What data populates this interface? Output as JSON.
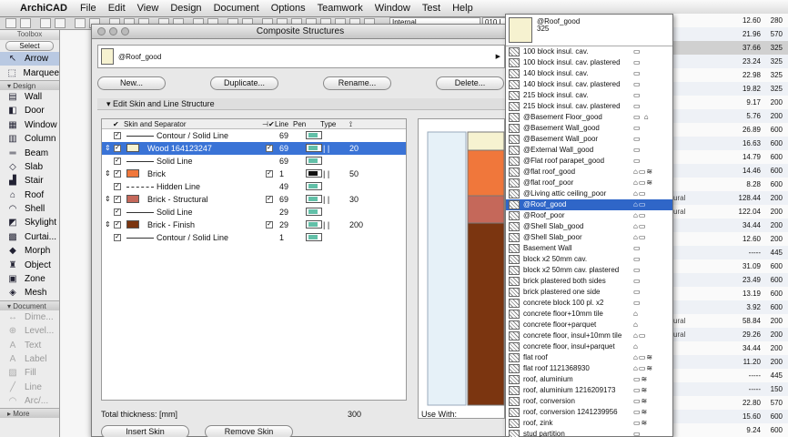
{
  "menubar": {
    "app": "ArchiCAD",
    "items": [
      "File",
      "Edit",
      "View",
      "Design",
      "Document",
      "Options",
      "Teamwork",
      "Window",
      "Test",
      "Help"
    ]
  },
  "topbar": {
    "layer": "Internal",
    "layer2": "010 L"
  },
  "toolbox": {
    "title": "Toolbox",
    "select": "Select",
    "tools_a": [
      {
        "label": "Arrow",
        "icon": "arrow-icon",
        "active": true
      },
      {
        "label": "Marquee",
        "icon": "marquee-icon"
      }
    ],
    "design_header": "Design",
    "tools_b": [
      {
        "label": "Wall",
        "icon": "wall-icon"
      },
      {
        "label": "Door",
        "icon": "door-icon"
      },
      {
        "label": "Window",
        "icon": "window-icon"
      },
      {
        "label": "Column",
        "icon": "column-icon"
      },
      {
        "label": "Beam",
        "icon": "beam-icon"
      },
      {
        "label": "Slab",
        "icon": "slab-icon"
      },
      {
        "label": "Stair",
        "icon": "stair-icon"
      },
      {
        "label": "Roof",
        "icon": "roof-icon"
      },
      {
        "label": "Shell",
        "icon": "shell-icon"
      },
      {
        "label": "Skylight",
        "icon": "skylight-icon"
      },
      {
        "label": "Curtai...",
        "icon": "curtain-wall-icon"
      },
      {
        "label": "Morph",
        "icon": "morph-icon"
      },
      {
        "label": "Object",
        "icon": "object-icon"
      },
      {
        "label": "Zone",
        "icon": "zone-icon"
      },
      {
        "label": "Mesh",
        "icon": "mesh-icon"
      }
    ],
    "document_header": "Document",
    "tools_c": [
      {
        "label": "Dime...",
        "icon": "dimension-icon"
      },
      {
        "label": "Level...",
        "icon": "level-icon"
      },
      {
        "label": "Text",
        "icon": "text-icon"
      },
      {
        "label": "Label",
        "icon": "label-icon"
      },
      {
        "label": "Fill",
        "icon": "fill-icon"
      },
      {
        "label": "Line",
        "icon": "line-icon"
      },
      {
        "label": "Arc/...",
        "icon": "arc-icon"
      }
    ],
    "more": "More"
  },
  "dialog": {
    "title": "Composite Structures",
    "name": "@Roof_good",
    "buttons": {
      "new": "New...",
      "duplicate": "Duplicate...",
      "rename": "Rename...",
      "delete": "Delete..."
    },
    "section": "Edit Skin and Line Structure",
    "headers": {
      "skin": "Skin and Separator",
      "line": "Line",
      "pen": "Pen",
      "type": "Type"
    },
    "rows": [
      {
        "kind": "line",
        "label": "Contour / Solid Line",
        "pen": "69",
        "thick": ""
      },
      {
        "kind": "skin",
        "label": "Wood 164123247",
        "pen": "69",
        "thick": "20",
        "color": "#f6f2d0",
        "selected": true
      },
      {
        "kind": "line",
        "label": "Solid Line",
        "pen": "69",
        "thick": ""
      },
      {
        "kind": "skin",
        "label": "Brick",
        "pen": "1",
        "thick": "50",
        "color": "#f0773b"
      },
      {
        "kind": "dash",
        "label": "Hidden Line",
        "pen": "49",
        "thick": ""
      },
      {
        "kind": "skin",
        "label": "Brick - Structural",
        "pen": "69",
        "thick": "30",
        "color": "#c5685a"
      },
      {
        "kind": "line",
        "label": "Solid Line",
        "pen": "29",
        "thick": ""
      },
      {
        "kind": "skin",
        "label": "Brick - Finish",
        "pen": "29",
        "thick": "200",
        "color": "#7b3510"
      },
      {
        "kind": "line",
        "label": "Contour / Solid Line",
        "pen": "1",
        "thick": ""
      }
    ],
    "total_label": "Total thickness: [mm]",
    "total_value": "300",
    "insert_skin": "Insert Skin",
    "remove_skin": "Remove Skin",
    "use_with": "Use With:"
  },
  "popup": {
    "current": "@Roof_good",
    "current_sub": "325",
    "items": [
      {
        "label": "100 block insul. cav.",
        "icons": "▭"
      },
      {
        "label": "100 block insul. cav. plastered",
        "icons": "▭"
      },
      {
        "label": "140 block insul. cav.",
        "icons": "▭"
      },
      {
        "label": "140 block insul. cav. plastered",
        "icons": "▭"
      },
      {
        "label": "215 block insul. cav.",
        "icons": "▭"
      },
      {
        "label": "215 block insul. cav. plastered",
        "icons": "▭"
      },
      {
        "label": "@Basement Floor_good",
        "icons": "▭ ⌂"
      },
      {
        "label": "@Basement Wall_good",
        "icons": "▭"
      },
      {
        "label": "@Basement Wall_poor",
        "icons": "▭"
      },
      {
        "label": "@External Wall_good",
        "icons": "▭"
      },
      {
        "label": "@Flat roof parapet_good",
        "icons": "▭"
      },
      {
        "label": "@flat roof_good",
        "icons": "⌂▭≋"
      },
      {
        "label": "@flat roof_poor",
        "icons": "⌂▭≋"
      },
      {
        "label": "@Living attic ceiling_poor",
        "icons": "⌂▭"
      },
      {
        "label": "@Roof_good",
        "icons": "⌂▭",
        "selected": true
      },
      {
        "label": "@Roof_poor",
        "icons": "⌂▭"
      },
      {
        "label": "@Shell Slab_good",
        "icons": "⌂▭"
      },
      {
        "label": "@Shell Slab_poor",
        "icons": "⌂▭"
      },
      {
        "label": "Basement Wall",
        "icons": "▭"
      },
      {
        "label": "block x2  50mm cav.",
        "icons": "▭"
      },
      {
        "label": "block x2  50mm cav. plastered",
        "icons": "▭"
      },
      {
        "label": "brick plastered both sides",
        "icons": "▭"
      },
      {
        "label": "brick plastered one side",
        "icons": "▭"
      },
      {
        "label": "concrete block 100 pl. x2",
        "icons": "▭"
      },
      {
        "label": "concrete floor+10mm tile",
        "icons": "⌂"
      },
      {
        "label": "concrete floor+parquet",
        "icons": "⌂"
      },
      {
        "label": "concrete floor, insul+10mm tile",
        "icons": "⌂▭"
      },
      {
        "label": "concrete floor, insul+parquet",
        "icons": "⌂"
      },
      {
        "label": "flat roof",
        "icons": "⌂▭≋"
      },
      {
        "label": "flat roof 1121368930",
        "icons": "⌂▭≋"
      },
      {
        "label": "roof, aluminium",
        "icons": "▭≋"
      },
      {
        "label": "roof, aluminium 1216209173",
        "icons": "▭≋"
      },
      {
        "label": "roof, conversion",
        "icons": "▭≋"
      },
      {
        "label": "roof, conversion 1241239956",
        "icons": "▭≋"
      },
      {
        "label": "roof, zink",
        "icons": "▭≋"
      },
      {
        "label": "stud partition",
        "icons": "▭"
      }
    ]
  },
  "right_table": [
    {
      "a": "12.60",
      "b": "280",
      "c": ""
    },
    {
      "a": "21.96",
      "b": "570",
      "c": ""
    },
    {
      "a": "37.66",
      "b": "325",
      "c": ""
    },
    {
      "a": "23.24",
      "b": "325",
      "c": ""
    },
    {
      "a": "22.98",
      "b": "325",
      "c": ""
    },
    {
      "a": "19.82",
      "b": "325",
      "c": ""
    },
    {
      "a": "9.17",
      "b": "200",
      "c": ""
    },
    {
      "a": "5.76",
      "b": "200",
      "c": ""
    },
    {
      "a": "26.89",
      "b": "600",
      "c": ""
    },
    {
      "a": "16.63",
      "b": "600",
      "c": ""
    },
    {
      "a": "14.79",
      "b": "600",
      "c": ""
    },
    {
      "a": "14.46",
      "b": "600",
      "c": ""
    },
    {
      "a": "8.28",
      "b": "600",
      "c": ""
    },
    {
      "a": "128.44",
      "b": "200",
      "c": "ural"
    },
    {
      "a": "122.04",
      "b": "200",
      "c": "ural"
    },
    {
      "a": "34.44",
      "b": "200",
      "c": ""
    },
    {
      "a": "12.60",
      "b": "200",
      "c": ""
    },
    {
      "a": "-----",
      "b": "445",
      "c": ""
    },
    {
      "a": "31.09",
      "b": "600",
      "c": ""
    },
    {
      "a": "23.49",
      "b": "600",
      "c": ""
    },
    {
      "a": "13.19",
      "b": "600",
      "c": ""
    },
    {
      "a": "3.92",
      "b": "600",
      "c": ""
    },
    {
      "a": "58.84",
      "b": "200",
      "c": "ural"
    },
    {
      "a": "29.26",
      "b": "200",
      "c": "ural"
    },
    {
      "a": "34.44",
      "b": "200",
      "c": ""
    },
    {
      "a": "11.20",
      "b": "200",
      "c": ""
    },
    {
      "a": "-----",
      "b": "445",
      "c": ""
    },
    {
      "a": "-----",
      "b": "150",
      "c": ""
    },
    {
      "a": "22.80",
      "b": "570",
      "c": ""
    },
    {
      "a": "15.60",
      "b": "600",
      "c": ""
    },
    {
      "a": "9.24",
      "b": "600",
      "c": ""
    }
  ]
}
